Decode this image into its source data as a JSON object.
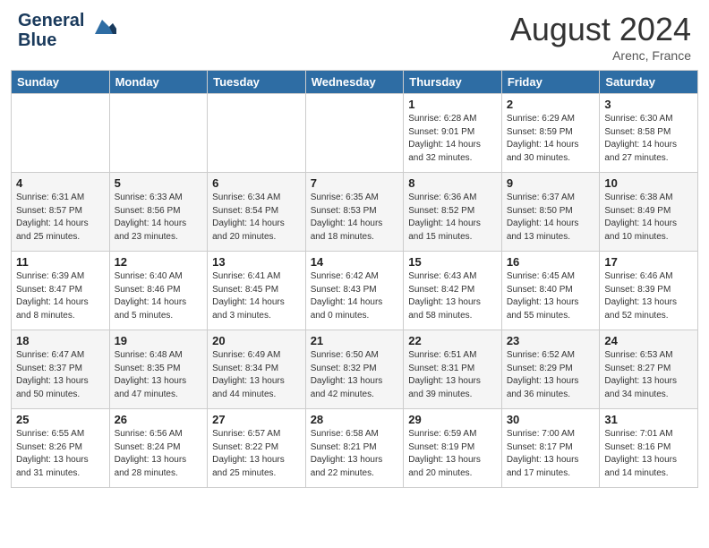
{
  "header": {
    "logo_line1": "General",
    "logo_line2": "Blue",
    "month": "August 2024",
    "location": "Arenc, France"
  },
  "weekdays": [
    "Sunday",
    "Monday",
    "Tuesday",
    "Wednesday",
    "Thursday",
    "Friday",
    "Saturday"
  ],
  "weeks": [
    [
      {
        "day": "",
        "info": ""
      },
      {
        "day": "",
        "info": ""
      },
      {
        "day": "",
        "info": ""
      },
      {
        "day": "",
        "info": ""
      },
      {
        "day": "1",
        "info": "Sunrise: 6:28 AM\nSunset: 9:01 PM\nDaylight: 14 hours\nand 32 minutes."
      },
      {
        "day": "2",
        "info": "Sunrise: 6:29 AM\nSunset: 8:59 PM\nDaylight: 14 hours\nand 30 minutes."
      },
      {
        "day": "3",
        "info": "Sunrise: 6:30 AM\nSunset: 8:58 PM\nDaylight: 14 hours\nand 27 minutes."
      }
    ],
    [
      {
        "day": "4",
        "info": "Sunrise: 6:31 AM\nSunset: 8:57 PM\nDaylight: 14 hours\nand 25 minutes."
      },
      {
        "day": "5",
        "info": "Sunrise: 6:33 AM\nSunset: 8:56 PM\nDaylight: 14 hours\nand 23 minutes."
      },
      {
        "day": "6",
        "info": "Sunrise: 6:34 AM\nSunset: 8:54 PM\nDaylight: 14 hours\nand 20 minutes."
      },
      {
        "day": "7",
        "info": "Sunrise: 6:35 AM\nSunset: 8:53 PM\nDaylight: 14 hours\nand 18 minutes."
      },
      {
        "day": "8",
        "info": "Sunrise: 6:36 AM\nSunset: 8:52 PM\nDaylight: 14 hours\nand 15 minutes."
      },
      {
        "day": "9",
        "info": "Sunrise: 6:37 AM\nSunset: 8:50 PM\nDaylight: 14 hours\nand 13 minutes."
      },
      {
        "day": "10",
        "info": "Sunrise: 6:38 AM\nSunset: 8:49 PM\nDaylight: 14 hours\nand 10 minutes."
      }
    ],
    [
      {
        "day": "11",
        "info": "Sunrise: 6:39 AM\nSunset: 8:47 PM\nDaylight: 14 hours\nand 8 minutes."
      },
      {
        "day": "12",
        "info": "Sunrise: 6:40 AM\nSunset: 8:46 PM\nDaylight: 14 hours\nand 5 minutes."
      },
      {
        "day": "13",
        "info": "Sunrise: 6:41 AM\nSunset: 8:45 PM\nDaylight: 14 hours\nand 3 minutes."
      },
      {
        "day": "14",
        "info": "Sunrise: 6:42 AM\nSunset: 8:43 PM\nDaylight: 14 hours\nand 0 minutes."
      },
      {
        "day": "15",
        "info": "Sunrise: 6:43 AM\nSunset: 8:42 PM\nDaylight: 13 hours\nand 58 minutes."
      },
      {
        "day": "16",
        "info": "Sunrise: 6:45 AM\nSunset: 8:40 PM\nDaylight: 13 hours\nand 55 minutes."
      },
      {
        "day": "17",
        "info": "Sunrise: 6:46 AM\nSunset: 8:39 PM\nDaylight: 13 hours\nand 52 minutes."
      }
    ],
    [
      {
        "day": "18",
        "info": "Sunrise: 6:47 AM\nSunset: 8:37 PM\nDaylight: 13 hours\nand 50 minutes."
      },
      {
        "day": "19",
        "info": "Sunrise: 6:48 AM\nSunset: 8:35 PM\nDaylight: 13 hours\nand 47 minutes."
      },
      {
        "day": "20",
        "info": "Sunrise: 6:49 AM\nSunset: 8:34 PM\nDaylight: 13 hours\nand 44 minutes."
      },
      {
        "day": "21",
        "info": "Sunrise: 6:50 AM\nSunset: 8:32 PM\nDaylight: 13 hours\nand 42 minutes."
      },
      {
        "day": "22",
        "info": "Sunrise: 6:51 AM\nSunset: 8:31 PM\nDaylight: 13 hours\nand 39 minutes."
      },
      {
        "day": "23",
        "info": "Sunrise: 6:52 AM\nSunset: 8:29 PM\nDaylight: 13 hours\nand 36 minutes."
      },
      {
        "day": "24",
        "info": "Sunrise: 6:53 AM\nSunset: 8:27 PM\nDaylight: 13 hours\nand 34 minutes."
      }
    ],
    [
      {
        "day": "25",
        "info": "Sunrise: 6:55 AM\nSunset: 8:26 PM\nDaylight: 13 hours\nand 31 minutes."
      },
      {
        "day": "26",
        "info": "Sunrise: 6:56 AM\nSunset: 8:24 PM\nDaylight: 13 hours\nand 28 minutes."
      },
      {
        "day": "27",
        "info": "Sunrise: 6:57 AM\nSunset: 8:22 PM\nDaylight: 13 hours\nand 25 minutes."
      },
      {
        "day": "28",
        "info": "Sunrise: 6:58 AM\nSunset: 8:21 PM\nDaylight: 13 hours\nand 22 minutes."
      },
      {
        "day": "29",
        "info": "Sunrise: 6:59 AM\nSunset: 8:19 PM\nDaylight: 13 hours\nand 20 minutes."
      },
      {
        "day": "30",
        "info": "Sunrise: 7:00 AM\nSunset: 8:17 PM\nDaylight: 13 hours\nand 17 minutes."
      },
      {
        "day": "31",
        "info": "Sunrise: 7:01 AM\nSunset: 8:16 PM\nDaylight: 13 hours\nand 14 minutes."
      }
    ]
  ]
}
